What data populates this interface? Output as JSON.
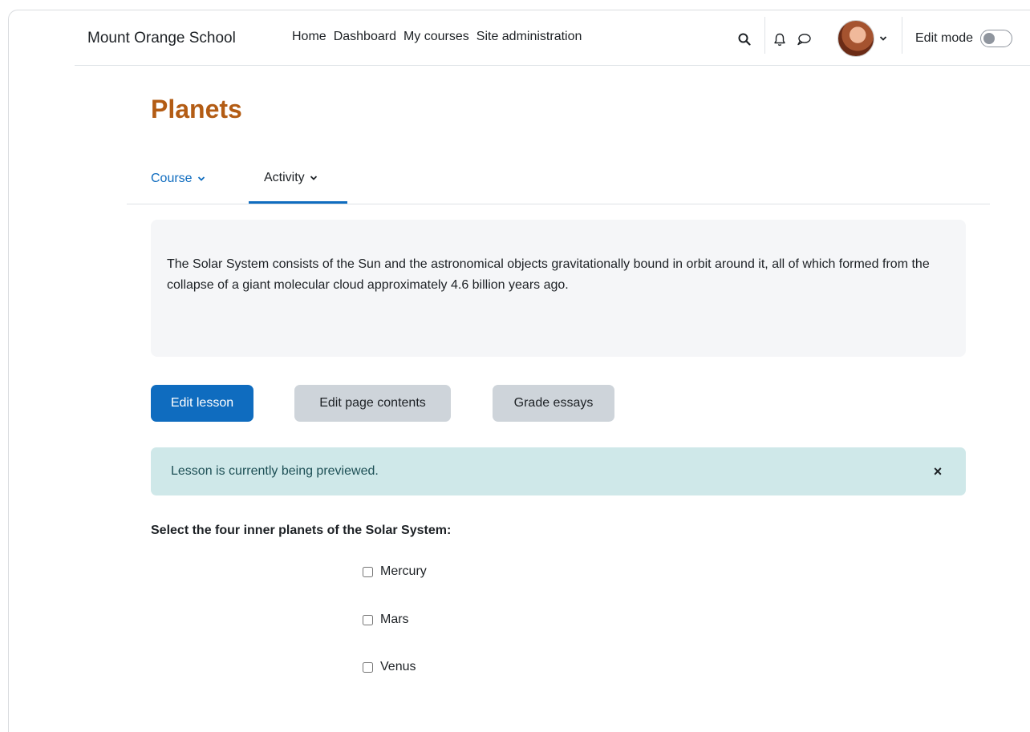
{
  "navbar": {
    "brand": "Mount Orange School",
    "nav_items": [
      "Home",
      "Dashboard",
      "My courses",
      "Site administration"
    ],
    "edit_mode_label": "Edit mode",
    "edit_mode_on": false,
    "icons": [
      "search-icon",
      "bell-icon",
      "chat-icon",
      "avatar",
      "chevron-down-icon"
    ]
  },
  "page": {
    "title": "Planets"
  },
  "secondary_nav": {
    "course_label": "Course",
    "activity_label": "Activity",
    "active": "Activity"
  },
  "intro": {
    "text": "The Solar System consists of the Sun and the astronomical objects gravitationally bound in orbit around it, all of which formed from the collapse of a giant molecular cloud approximately 4.6 billion years ago."
  },
  "actions": {
    "edit_lesson": "Edit lesson",
    "edit_page_contents": "Edit page contents",
    "grade_essays": "Grade essays"
  },
  "alert": {
    "message": "Lesson is currently being previewed.",
    "close_symbol": "×"
  },
  "question": {
    "prompt": "Select the four inner planets of the Solar System:",
    "options": [
      {
        "label": "Mercury",
        "checked": false
      },
      {
        "label": "Mars",
        "checked": false
      },
      {
        "label": "Venus",
        "checked": false
      }
    ]
  },
  "colors": {
    "accent": "#0f6cbf",
    "title": "#b35c14",
    "alert_bg": "#cfe8e9"
  }
}
